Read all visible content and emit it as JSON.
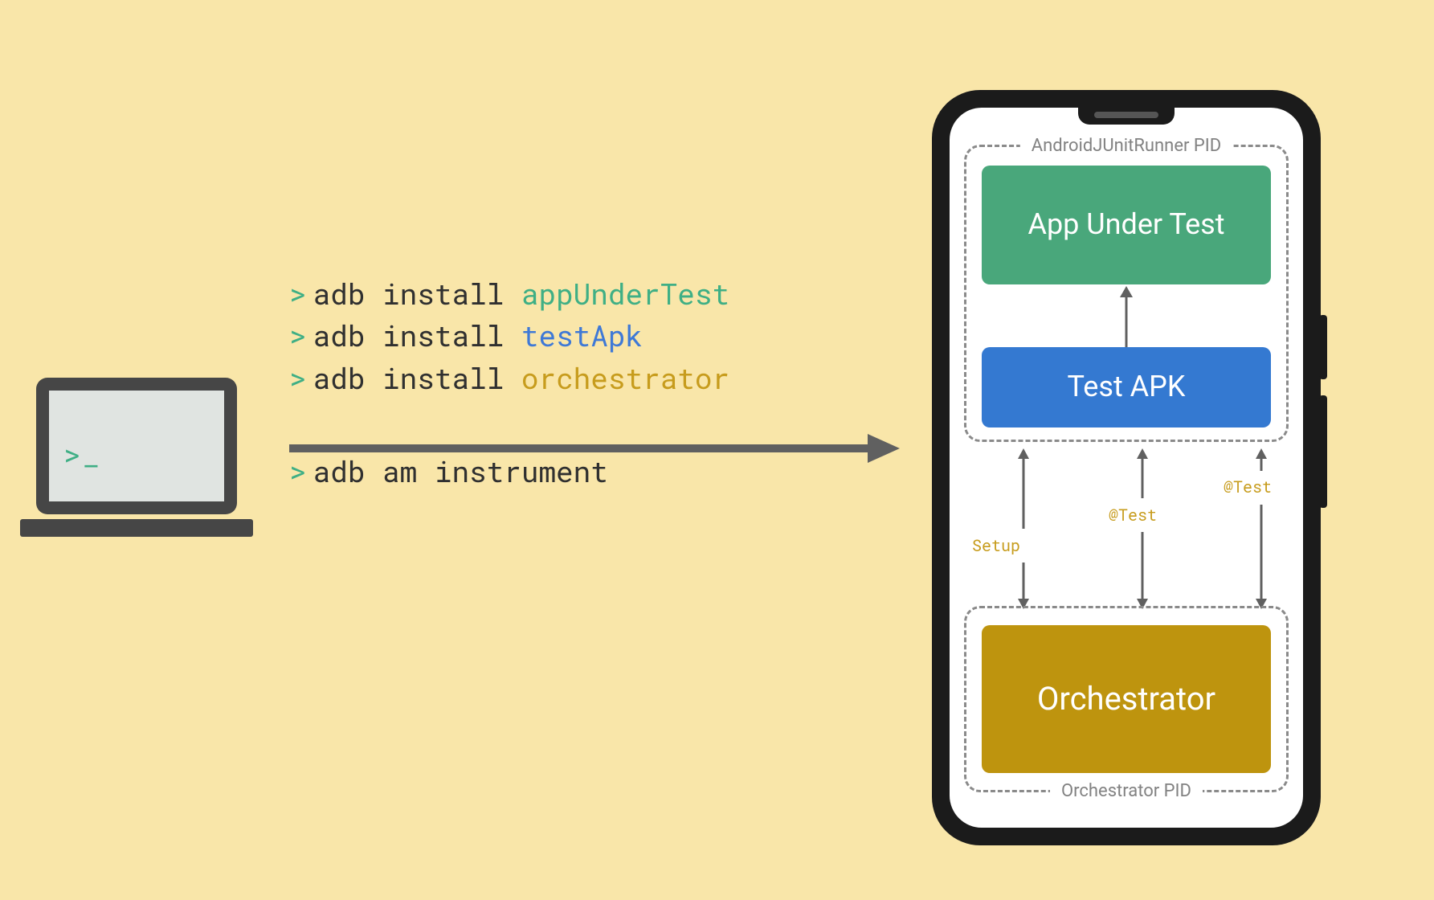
{
  "laptop": {
    "prompt": ">_"
  },
  "terminal": {
    "rows": [
      {
        "chev": ">",
        "cmd": "adb install ",
        "arg": "appUnderTest",
        "argClass": "arg-green"
      },
      {
        "chev": ">",
        "cmd": "adb install ",
        "arg": "testApk",
        "argClass": "arg-blue"
      },
      {
        "chev": ">",
        "cmd": "adb install ",
        "arg": "orchestrator",
        "argClass": "arg-gold"
      }
    ],
    "final": {
      "chev": ">",
      "cmd": "adb am instrument"
    }
  },
  "phone": {
    "runnerLabel": "AndroidJUnitRunner PID",
    "orchestratorLabel": "Orchestrator PID",
    "blocks": {
      "app": "App Under Test",
      "test": "Test APK",
      "orch": "Orchestrator"
    },
    "triLabels": {
      "a": "Setup",
      "b": "@Test",
      "c": "@Test"
    }
  },
  "colors": {
    "green": "#3FAF85",
    "blue": "#3F79D6",
    "gold": "#C79C1D",
    "arrow": "#606060"
  }
}
